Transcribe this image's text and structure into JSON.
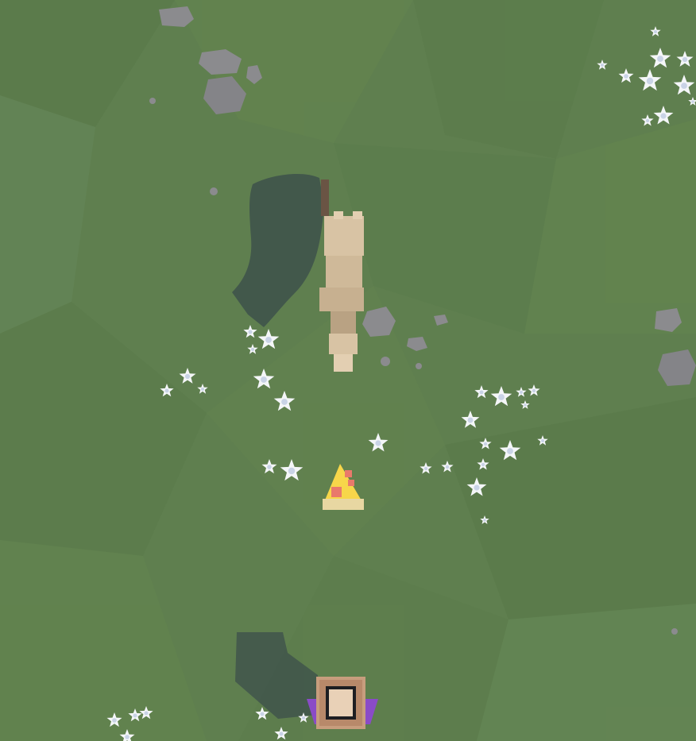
{
  "scene": {
    "type": "top-down 3D low-poly game view",
    "colors": {
      "grass": "#5f7f4f",
      "grass_dark": "#557447",
      "grass_light": "#688a56",
      "rock": "#8b8b8e",
      "rock_dark": "#6e6e72",
      "flower": "#f4f6f8",
      "flower_center": "#c9d3e6",
      "shadow": "#2f3e4a",
      "cat_body": "#d8c3a4",
      "cat_dark": "#b9a283",
      "cat_tail": "#6a5444",
      "pizza_crust": "#e8d7a2",
      "pizza_cheese": "#f7d64a",
      "pizza_topping": "#e9796b",
      "box_frame": "#c79d7d",
      "box_center": "#e9d1b7",
      "box_accent": "#8a4bc7"
    },
    "icons": [
      "rock-icon",
      "flower-icon",
      "cat-character-icon",
      "pizza-slice-icon",
      "crate-icon"
    ]
  }
}
